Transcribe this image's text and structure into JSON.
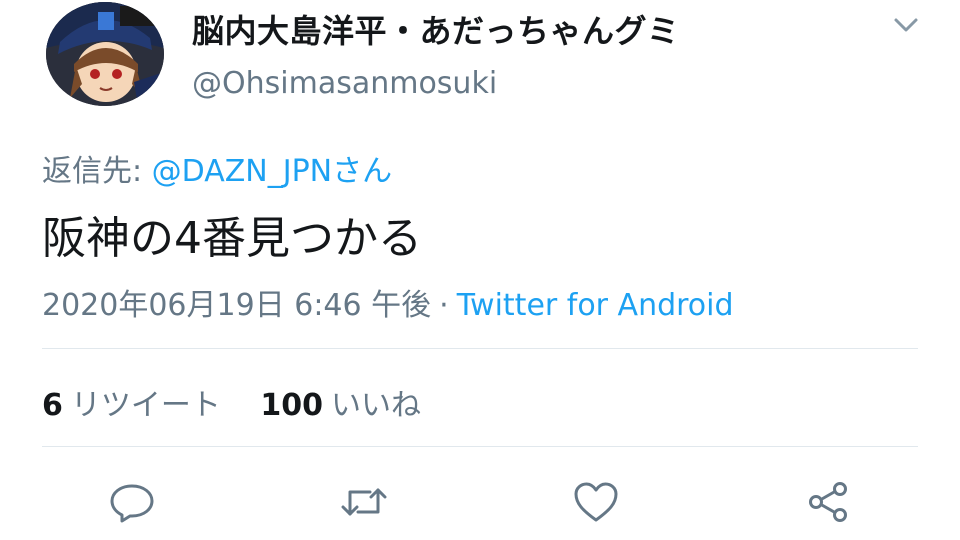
{
  "user": {
    "display_name": "脳内大島洋平・あだっちゃんグミ",
    "handle": "@Ohsimasanmosuki"
  },
  "tweet": {
    "reply_prefix": "返信先: ",
    "reply_user": "@DAZN_JPNさん",
    "text": "阪神の4番見つかる",
    "timestamp": "2020年06月19日 6:46 午後",
    "separator": "·",
    "source": "Twitter for Android"
  },
  "stats": {
    "retweets_count": "6",
    "retweets_label": "リツイート",
    "likes_count": "100",
    "likes_label": "いいね"
  },
  "actions": [
    "reply-icon",
    "retweet-icon",
    "like-icon",
    "share-icon"
  ],
  "colors": {
    "link": "#1da1f2",
    "secondary_text": "#657786",
    "primary_text": "#14171a",
    "divider": "#e1e8ed"
  }
}
